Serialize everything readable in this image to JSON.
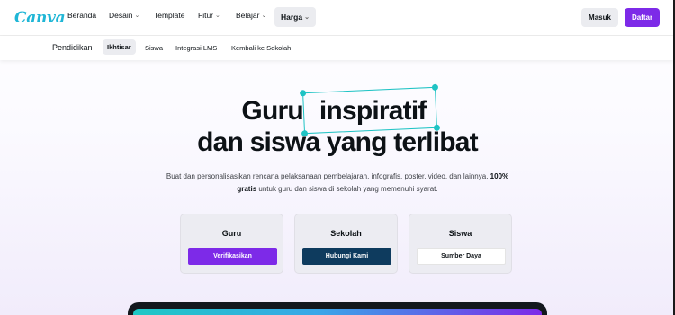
{
  "nav": {
    "logo": "Canva",
    "items": [
      {
        "label": "Beranda",
        "chevron": false
      },
      {
        "label": "Desain",
        "chevron": true
      },
      {
        "label": "Template",
        "chevron": false
      },
      {
        "label": "Fitur",
        "chevron": true
      },
      {
        "label": "Belajar",
        "chevron": true
      },
      {
        "label": "Harga",
        "chevron": true,
        "active": true
      }
    ],
    "login_label": "Masuk",
    "signup_label": "Daftar",
    "chevron_glyph": "⌵"
  },
  "subnav": {
    "title": "Pendidikan",
    "items": [
      {
        "label": "Ikhtisar",
        "active": true
      },
      {
        "label": "Siswa"
      },
      {
        "label": "Integrasi LMS"
      },
      {
        "label": "Kembali ke Sekolah"
      }
    ]
  },
  "hero": {
    "line1_a": "Guru",
    "line1_b": "inspiratif",
    "line2": "dan siswa yang terlibat",
    "desc_1": "Buat dan personalisasikan rencana pelaksanaan pembelajaran, infografis, poster, video, dan lainnya.",
    "desc_bold": "100% gratis",
    "desc_2": "untuk guru dan siswa di sekolah yang memenuhi syarat."
  },
  "cards": [
    {
      "title": "Guru",
      "button": "Verifikasikan",
      "style": "purple"
    },
    {
      "title": "Sekolah",
      "button": "Hubungi Kami",
      "style": "navy"
    },
    {
      "title": "Siswa",
      "button": "Sumber Daya",
      "style": "white"
    }
  ],
  "colors": {
    "brand_purple": "#7d2ae8",
    "logo_teal": "#1fb6d6",
    "selection_teal": "#1fc3c4",
    "navy": "#0e3b5e"
  }
}
